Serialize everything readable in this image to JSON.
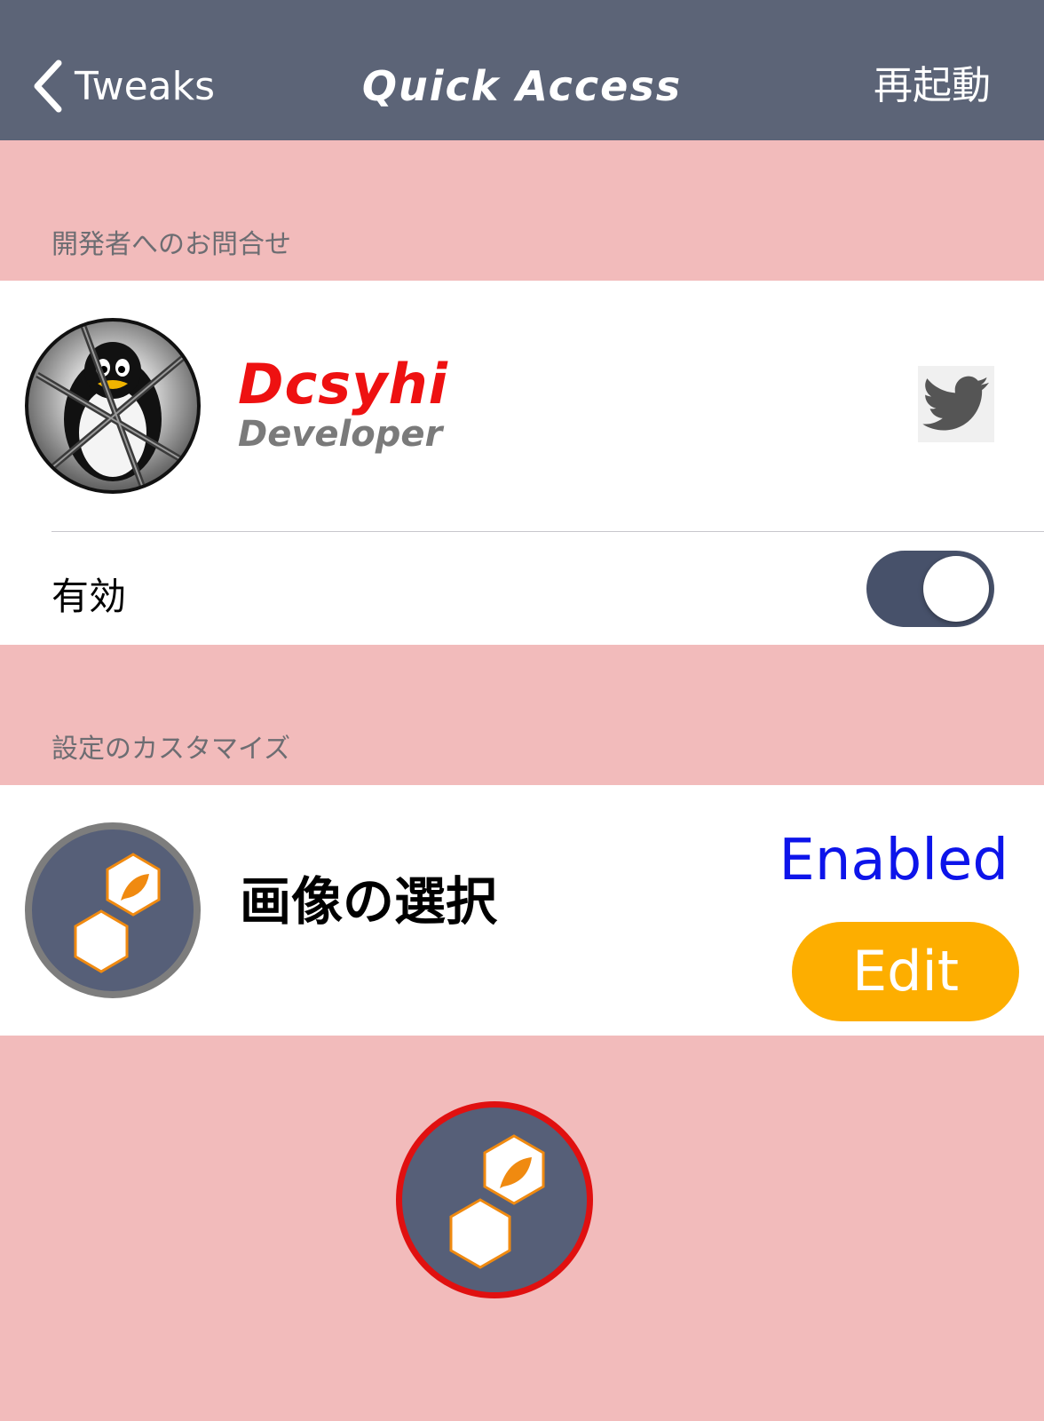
{
  "nav": {
    "back_label": "Tweaks",
    "title": "Quick Access",
    "right_button": "再起動"
  },
  "sections": [
    {
      "header": "開発者へのお問合せ"
    },
    {
      "header": "設定のカスタマイズ"
    }
  ],
  "developer": {
    "name": "Dcsyhi",
    "role": "Developer",
    "social_icon": "twitter-icon"
  },
  "enable_row": {
    "label": "有効",
    "toggle_on": true
  },
  "image_select": {
    "label": "画像の選択",
    "status": "Enabled",
    "edit_label": "Edit"
  },
  "colors": {
    "navbar": "#5c6477",
    "background": "#f2bbbb",
    "accent_orange": "#fdae00",
    "status_blue": "#0d14ea",
    "developer_red": "#ee1111",
    "preview_border": "#e01010"
  }
}
